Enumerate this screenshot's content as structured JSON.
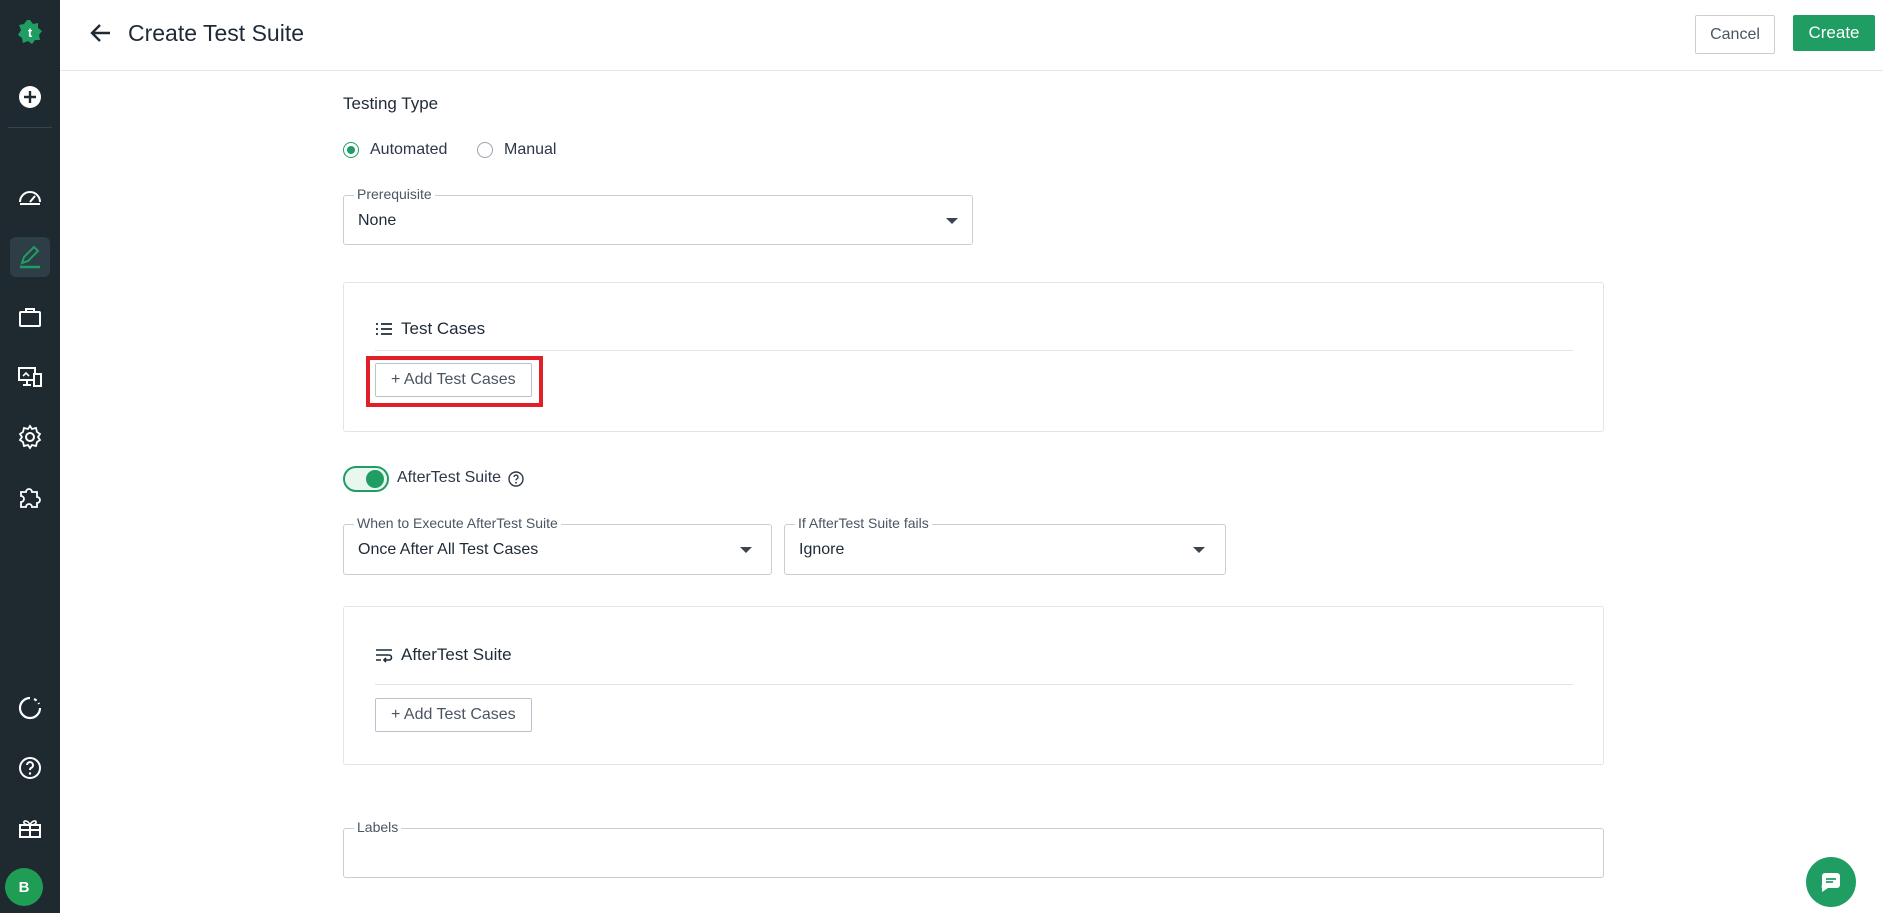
{
  "header": {
    "title": "Create Test Suite",
    "cancel_label": "Cancel",
    "create_label": "Create"
  },
  "testing_type": {
    "label": "Testing Type",
    "options": [
      "Automated",
      "Manual"
    ],
    "selected": "Automated"
  },
  "prerequisite": {
    "label": "Prerequisite",
    "value": "None"
  },
  "test_cases_card": {
    "title": "Test Cases",
    "add_button": "+ Add Test Cases"
  },
  "after_test_suite": {
    "toggle_label": "AfterTest Suite",
    "enabled": true,
    "when_label": "When to Execute AfterTest Suite",
    "when_value": "Once After All Test Cases",
    "fails_label": "If AfterTest Suite fails",
    "fails_value": "Ignore",
    "card_title": "AfterTest Suite",
    "add_button": "+ Add Test Cases"
  },
  "labels_field": {
    "label": "Labels",
    "value": ""
  },
  "sidebar": {
    "avatar_initial": "B",
    "icons": [
      "logo-icon",
      "add-icon",
      "dashboard-icon",
      "edit-icon",
      "briefcase-icon",
      "devices-icon",
      "settings-icon",
      "puzzle-icon",
      "refresh-icon",
      "help-icon",
      "gift-icon"
    ]
  },
  "colors": {
    "accent": "#1f9d63",
    "sidebar_bg": "#1f2a30",
    "highlight": "#e01f26"
  }
}
